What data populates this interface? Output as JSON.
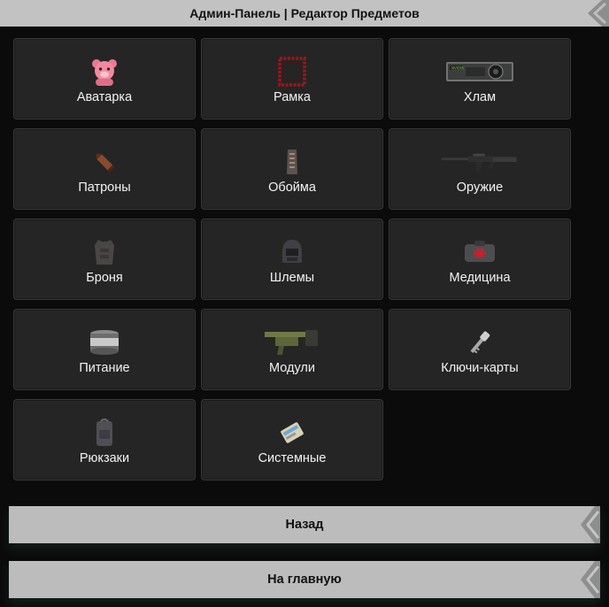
{
  "header": {
    "title": "Админ-Панель | Редактор Предметов"
  },
  "categories": [
    {
      "label": "Аватарка",
      "icon": "pink-bear-icon"
    },
    {
      "label": "Рамка",
      "icon": "red-frame-icon"
    },
    {
      "label": "Хлам",
      "icon": "graphics-card-icon"
    },
    {
      "label": "Патроны",
      "icon": "bullet-icon"
    },
    {
      "label": "Обойма",
      "icon": "magazine-icon"
    },
    {
      "label": "Оружие",
      "icon": "rifle-icon"
    },
    {
      "label": "Броня",
      "icon": "body-armor-icon"
    },
    {
      "label": "Шлемы",
      "icon": "helmet-icon"
    },
    {
      "label": "Медицина",
      "icon": "medkit-icon"
    },
    {
      "label": "Питание",
      "icon": "food-can-icon"
    },
    {
      "label": "Модули",
      "icon": "weapon-module-icon"
    },
    {
      "label": "Ключи-карты",
      "icon": "keycard-icon"
    },
    {
      "label": "Рюкзаки",
      "icon": "backpack-icon"
    },
    {
      "label": "Системные",
      "icon": "system-item-icon"
    }
  ],
  "buttons": {
    "back": "Назад",
    "home": "На главную"
  },
  "colors": {
    "background": "#0b0b0b",
    "tile": "#252525",
    "bar": "#c2c2c2",
    "text": "#f2f2f2"
  }
}
